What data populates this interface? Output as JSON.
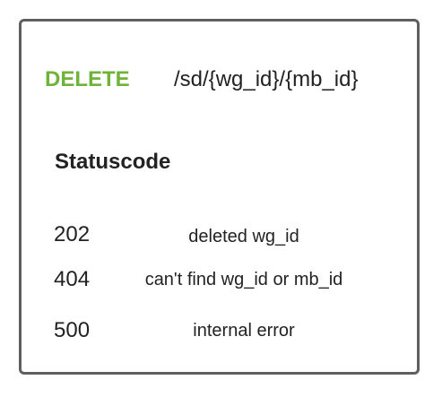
{
  "method": {
    "label": "DELETE",
    "color": "#6fb33a"
  },
  "endpoint": "/sd/{wg_id}/{mb_id}",
  "section_title": "Statuscode",
  "status_codes": [
    {
      "code": "202",
      "description": "deleted wg_id"
    },
    {
      "code": "404",
      "description": "can't find wg_id or mb_id"
    },
    {
      "code": "500",
      "description": "internal error"
    }
  ]
}
